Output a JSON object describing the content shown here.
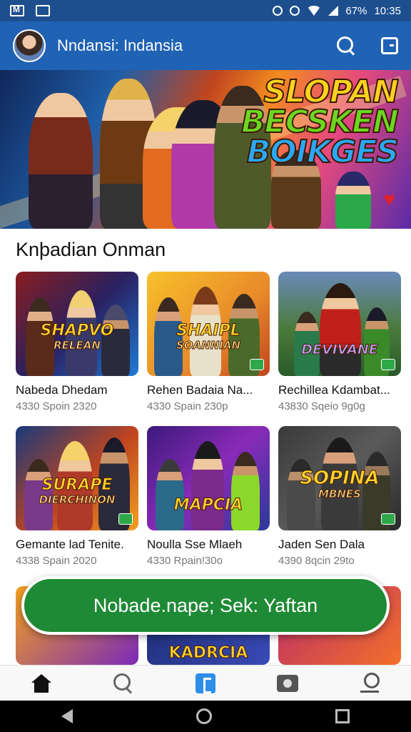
{
  "status_bar": {
    "battery": "67%",
    "time": "10:35"
  },
  "app_bar": {
    "title": "Nndansi: Indansia"
  },
  "section": {
    "title": "Knþadian Onman"
  },
  "cards": [
    {
      "title": "Nabeda Dhedam",
      "meta": "4330 Spoin 2320",
      "logo_main": "SHAPVO",
      "logo_sub": "RELEAN"
    },
    {
      "title": "Rehen Badaia Na...",
      "meta": "4330 Spain 230p",
      "logo_main": "SHAIPL",
      "logo_sub": "SOANNIAN"
    },
    {
      "title": "Rechillea Kdambat...",
      "meta": "43830 Sqeio 9g0g",
      "logo_main": "DEVIVANE",
      "logo_sub": ""
    },
    {
      "title": "Gemante lad Tenite.",
      "meta": "4338 Spain 2020",
      "logo_main": "SURAPE",
      "logo_sub": "DIERCHINON"
    },
    {
      "title": "Noulla Sse Mlaeh",
      "meta": "4330 Rpain!30o",
      "logo_main": "MAPCIA",
      "logo_sub": ""
    },
    {
      "title": "Jaden Sen Dala",
      "meta": "4390 8qcin 29to",
      "logo_main": "SOPINA",
      "logo_sub": "MBNES"
    }
  ],
  "banner": {
    "line1": "SLOPAN",
    "line2": "BECSKEN",
    "line3": "BOIKGES"
  },
  "peek": {
    "center_logo": "KADRCIA"
  },
  "cta": {
    "label": "Nobade.napе; Sek: Yaftan"
  },
  "icons": {
    "home": "home-icon",
    "search": "search-icon",
    "library": "library-icon",
    "camera": "camera-icon",
    "location": "location-pin-icon"
  },
  "colors": {
    "app_bar": "#2062b4",
    "status_bar": "#1d4f8f",
    "cta": "#1f8a35",
    "active_nav": "#2f8ee8"
  }
}
